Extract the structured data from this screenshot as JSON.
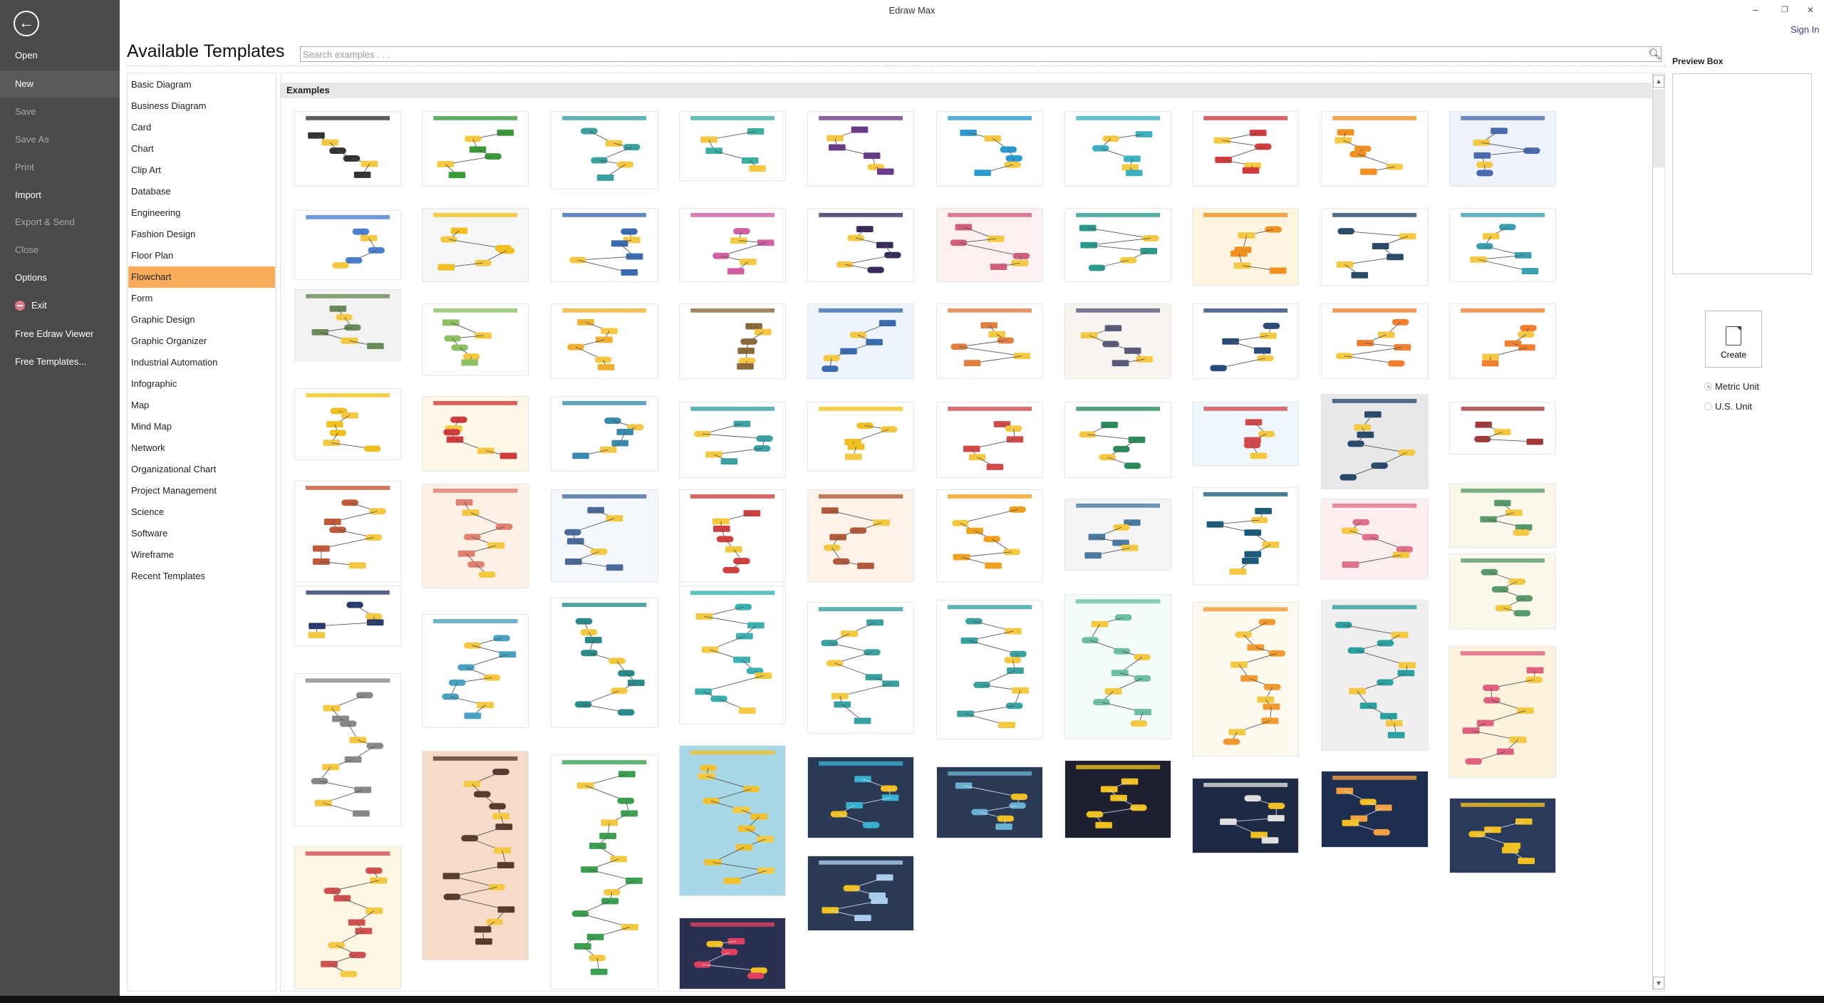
{
  "app": {
    "title": "Edraw Max",
    "sign_in": "Sign In",
    "minimize": "–",
    "restore": "❐",
    "close": "✕"
  },
  "sidebar": {
    "back_icon": "arrow-left-circle-icon",
    "items": [
      {
        "label": "Open",
        "state": "enabled"
      },
      {
        "label": "New",
        "state": "selected"
      },
      {
        "label": "Save",
        "state": "disabled"
      },
      {
        "label": "Save As",
        "state": "disabled"
      },
      {
        "label": "Print",
        "state": "disabled"
      },
      {
        "label": "Import",
        "state": "enabled"
      },
      {
        "label": "Export & Send",
        "state": "disabled"
      },
      {
        "label": "Close",
        "state": "disabled"
      },
      {
        "label": "Options",
        "state": "enabled"
      },
      {
        "label": "Exit",
        "state": "enabled",
        "icon": "exit-icon"
      },
      {
        "label": "Free Edraw Viewer",
        "state": "enabled"
      },
      {
        "label": "Free Templates...",
        "state": "enabled"
      }
    ]
  },
  "main": {
    "title": "Available Templates",
    "search": {
      "placeholder": "Search examples . . .",
      "value": ""
    },
    "examples_header": "Examples",
    "categories": [
      "Basic Diagram",
      "Business Diagram",
      "Card",
      "Chart",
      "Clip Art",
      "Database",
      "Engineering",
      "Fashion Design",
      "Floor Plan",
      "Flowchart",
      "Form",
      "Graphic Design",
      "Graphic Organizer",
      "Industrial Automation",
      "Infographic",
      "Map",
      "Mind Map",
      "Network",
      "Organizational Chart",
      "Project Management",
      "Science",
      "Software",
      "Wireframe",
      "Recent Templates"
    ],
    "selected_category": "Flowchart",
    "accent": "#f9ad5c",
    "thumbnail_columns": [
      [
        [
          "#ffffff",
          "#333333"
        ],
        [
          "#ffffff",
          "#4a7fd0"
        ],
        [
          "#f2f2f2",
          "#6a8a5a"
        ],
        [
          "#ffffff",
          "#f0c020"
        ],
        [
          "#ffffff",
          "#c0583a"
        ],
        [
          "#ffffff",
          "#2a3a6a"
        ],
        [
          "#ffffff",
          "#888888"
        ],
        [
          "#fdf6e3",
          "#d05050"
        ]
      ],
      [
        [
          "#ffffff",
          "#3a9a3a"
        ],
        [
          "#f4f6f8",
          "#f0c020"
        ],
        [
          "#ffffff",
          "#8cc060"
        ],
        [
          "#fff8e8",
          "#d03a3a"
        ],
        [
          "#fdf0e6",
          "#e08070"
        ],
        [
          "#ffffff",
          "#4aa0c0"
        ],
        [
          "#f6dcc8",
          "#5a3a2a"
        ]
      ],
      [
        [
          "#ffffff",
          "#3aa0a0"
        ],
        [
          "#ffffff",
          "#3a6ab0"
        ],
        [
          "#ffffff",
          "#f0b030"
        ],
        [
          "#ffffff",
          "#3a8ab0"
        ],
        [
          "#f4f8fc",
          "#4a6a9a"
        ],
        [
          "#ffffff",
          "#2a8a8a"
        ],
        [
          "#ffffff",
          "#3aa050"
        ]
      ],
      [
        [
          "#ffffff",
          "#3ab0a0"
        ],
        [
          "#ffffff",
          "#d060a0"
        ],
        [
          "#ffffff",
          "#8a6a3a"
        ],
        [
          "#ffffff",
          "#3aa0a0"
        ],
        [
          "#ffffff",
          "#d04040"
        ],
        [
          "#ffffff",
          "#3ab0b0"
        ],
        [
          "#a8d8e6",
          "#f0c030"
        ],
        [
          "#2a3050",
          "#e04060"
        ]
      ],
      [
        [
          "#ffffff",
          "#6a3a8a"
        ],
        [
          "#ffffff",
          "#3a2a5a"
        ],
        [
          "#eef4fb",
          "#3a6ab0"
        ],
        [
          "#ffffff",
          "#f0c020"
        ],
        [
          "#fdf2ea",
          "#b05a3a"
        ],
        [
          "#ffffff",
          "#3aa0a0"
        ],
        [
          "#2a3a55",
          "#3ab0d0"
        ],
        [
          "#2a3a55",
          "#aaccee"
        ]
      ],
      [
        [
          "#ffffff",
          "#2a9ad0"
        ],
        [
          "#fdf0f0",
          "#d0607a"
        ],
        [
          "#ffffff",
          "#e08040"
        ],
        [
          "#ffffff",
          "#d04a4a"
        ],
        [
          "#ffffff",
          "#f0a020"
        ],
        [
          "#ffffff",
          "#3aa0a0"
        ],
        [
          "#2a3a55",
          "#6ab0d0"
        ]
      ],
      [
        [
          "#ffffff",
          "#3ab0c0"
        ],
        [
          "#ffffff",
          "#2a9a8a"
        ],
        [
          "#f8f4f0",
          "#5a5a7a"
        ],
        [
          "#ffffff",
          "#2a8a5a"
        ],
        [
          "#f4f4f4",
          "#4a7aa0"
        ],
        [
          "#f4fcfa",
          "#6ac0a0"
        ],
        [
          "#1e2030",
          "#f0c020"
        ]
      ],
      [
        [
          "#ffffff",
          "#d03a3a"
        ],
        [
          "#fff4e0",
          "#f09020"
        ],
        [
          "#ffffff",
          "#2a4a7a"
        ],
        [
          "#eef8fc",
          "#d04a4a"
        ],
        [
          "#ffffff",
          "#1a5a7a"
        ],
        [
          "#fffaf0",
          "#f09a30"
        ],
        [
          "#1e2a44",
          "#e0e0e0"
        ]
      ],
      [
        [
          "#ffffff",
          "#f09020"
        ],
        [
          "#ffffff",
          "#2a4a6a"
        ],
        [
          "#ffffff",
          "#f08030"
        ],
        [
          "#e8e8e8",
          "#2a4a6a"
        ],
        [
          "#fdeef0",
          "#e0708a"
        ],
        [
          "#f0eeee",
          "#2aa0a0"
        ],
        [
          "#1e2e50",
          "#f0a040"
        ]
      ],
      [
        [
          "#eef2fa",
          "#4a6ab0"
        ],
        [
          "#ffffff",
          "#3aa0b0"
        ],
        [
          "#ffffff",
          "#f08030"
        ],
        [
          "#ffffff",
          "#a03a3a"
        ],
        [
          "#fdf8ec",
          "#5a9a6a"
        ],
        [
          "#fdf8ec",
          "#5a9a6a"
        ],
        [
          "#fdf2dc",
          "#e06080"
        ],
        [
          "#2a3a5a",
          "#f0c020"
        ]
      ]
    ]
  },
  "preview": {
    "label": "Preview Box",
    "create_label": "Create",
    "create_icon": "new-document-icon",
    "units": [
      {
        "label": "Metric Unit",
        "selected": true
      },
      {
        "label": "U.S. Unit",
        "selected": false
      }
    ]
  }
}
